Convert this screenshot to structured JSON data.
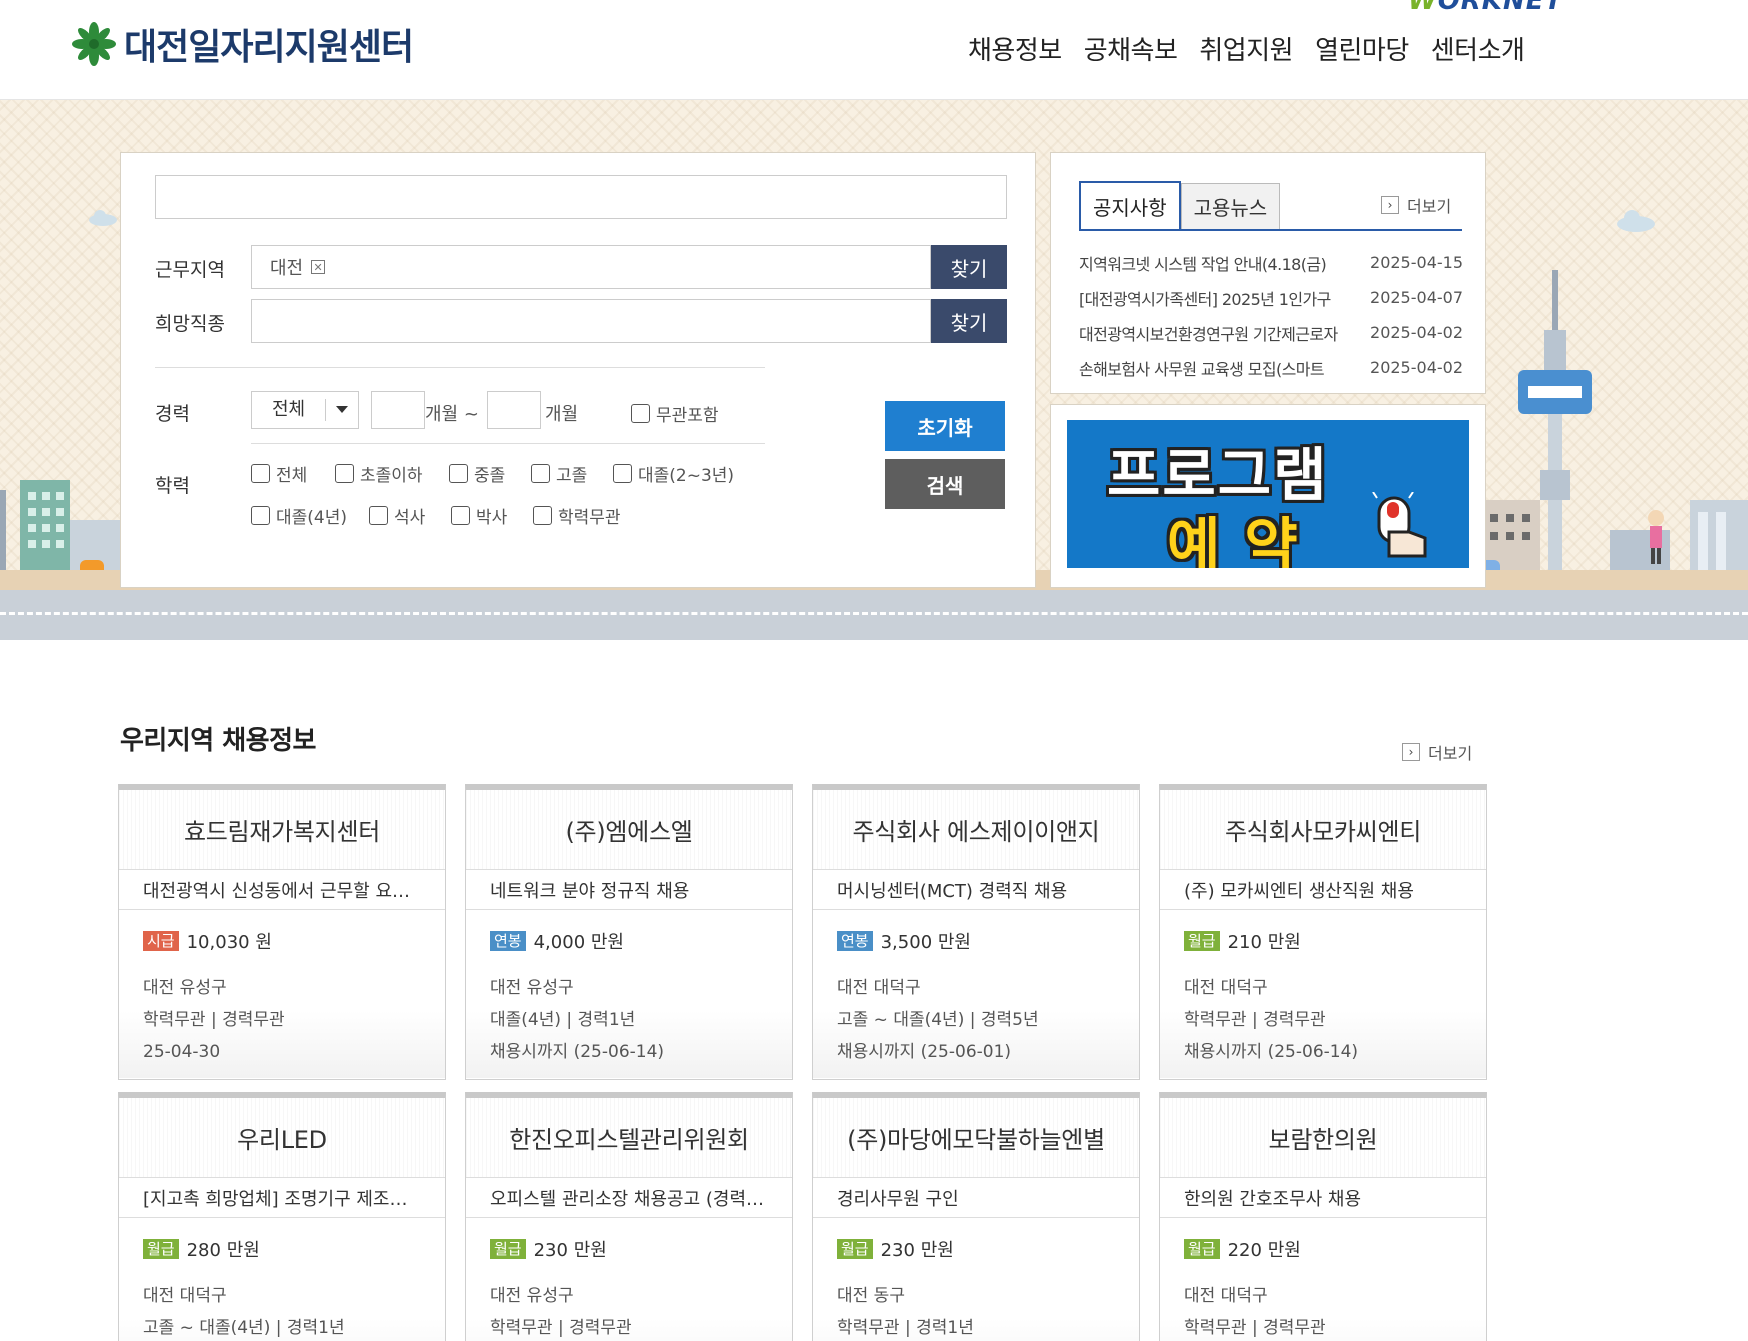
{
  "header": {
    "site_title": "대전일자리지원센터",
    "worknet_brand": "WORKNET",
    "nav": [
      "채용정보",
      "공채속보",
      "취업지원",
      "열린마당",
      "센터소개"
    ]
  },
  "search": {
    "keyword_value": "",
    "region_label": "근무지역",
    "region_value": "대전",
    "job_label": "희망직종",
    "find_label": "찾기",
    "career_label": "경력",
    "career_select": "전체",
    "month_from_suffix": "개월 ~",
    "month_to_suffix": "개월",
    "any_career_label": "무관포함",
    "education_label": "학력",
    "education_options": [
      "전체",
      "초졸이하",
      "중졸",
      "고졸",
      "대졸(2~3년)",
      "대졸(4년)",
      "석사",
      "박사",
      "학력무관"
    ],
    "reset_label": "초기화",
    "search_label": "검색"
  },
  "notice": {
    "tabs": [
      "공지사항",
      "고용뉴스"
    ],
    "more_label": "더보기",
    "items": [
      {
        "title": "지역워크넷 시스템 작업 안내(4.18(금)",
        "date": "2025-04-15"
      },
      {
        "title": "[대전광역시가족센터] 2025년 1인가구",
        "date": "2025-04-07"
      },
      {
        "title": "대전광역시보건환경연구원 기간제근로자",
        "date": "2025-04-02"
      },
      {
        "title": "손해보험사 사무원 교육생 모집(스마트",
        "date": "2025-04-02"
      }
    ]
  },
  "banner": {
    "line1": "프로그램",
    "line2": "예약"
  },
  "jobs_section": {
    "title": "우리지역 채용정보",
    "more_label": "더보기",
    "colors": {
      "시급": "#e0644a",
      "연봉": "#4a8fc7",
      "월급": "#7fb13a"
    },
    "jobs": [
      {
        "company": "효드림재가복지센터",
        "title": "대전광역시 신성동에서 근무할 요양보호사",
        "wage_type": "시급",
        "wage": "10,030 원",
        "location": "대전 유성구",
        "requirements": "학력무관 | 경력무관",
        "deadline": "25-04-30"
      },
      {
        "company": "(주)엠에스엘",
        "title": "네트워크 분야 정규직 채용",
        "wage_type": "연봉",
        "wage": "4,000 만원",
        "location": "대전 유성구",
        "requirements": "대졸(4년) | 경력1년",
        "deadline": "채용시까지 (25-06-14)"
      },
      {
        "company": "주식회사 에스제이이앤지",
        "title": "머시닝센터(MCT) 경력직 채용",
        "wage_type": "연봉",
        "wage": "3,500 만원",
        "location": "대전 대덕구",
        "requirements": "고졸 ~ 대졸(4년) | 경력5년",
        "deadline": "채용시까지 (25-06-01)"
      },
      {
        "company": "주식회사모카씨엔티",
        "title": "(주) 모카씨엔티 생산직원 채용",
        "wage_type": "월급",
        "wage": "210 만원",
        "location": "대전 대덕구",
        "requirements": "학력무관 | 경력무관",
        "deadline": "채용시까지 (25-06-14)"
      },
      {
        "company": "우리LED",
        "title": "[지고촉 희망업체] 조명기구 제조원 모집",
        "wage_type": "월급",
        "wage": "280 만원",
        "location": "대전 대덕구",
        "requirements": "고졸 ~ 대졸(4년) | 경력1년",
        "deadline": ""
      },
      {
        "company": "한진오피스텔관리위원회",
        "title": "오피스텔 관리소장 채용공고 (경력자)",
        "wage_type": "월급",
        "wage": "230 만원",
        "location": "대전 유성구",
        "requirements": "학력무관 | 경력무관",
        "deadline": ""
      },
      {
        "company": "(주)마당에모닥불하늘엔별",
        "title": "경리사무원 구인",
        "wage_type": "월급",
        "wage": "230 만원",
        "location": "대전 동구",
        "requirements": "학력무관 | 경력1년",
        "deadline": ""
      },
      {
        "company": "보람한의원",
        "title": "한의원 간호조무사 채용",
        "wage_type": "월급",
        "wage": "220 만원",
        "location": "대전 대덕구",
        "requirements": "학력무관 | 경력무관",
        "deadline": ""
      }
    ]
  }
}
